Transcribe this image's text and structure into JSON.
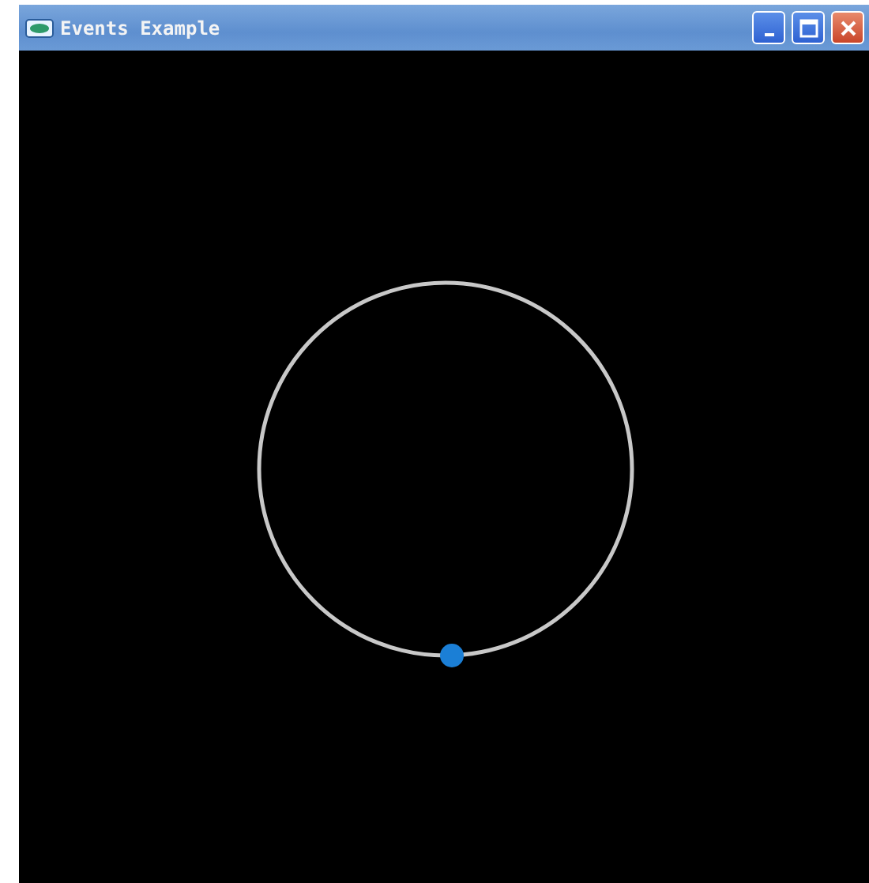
{
  "window": {
    "title": "Events Example"
  }
}
